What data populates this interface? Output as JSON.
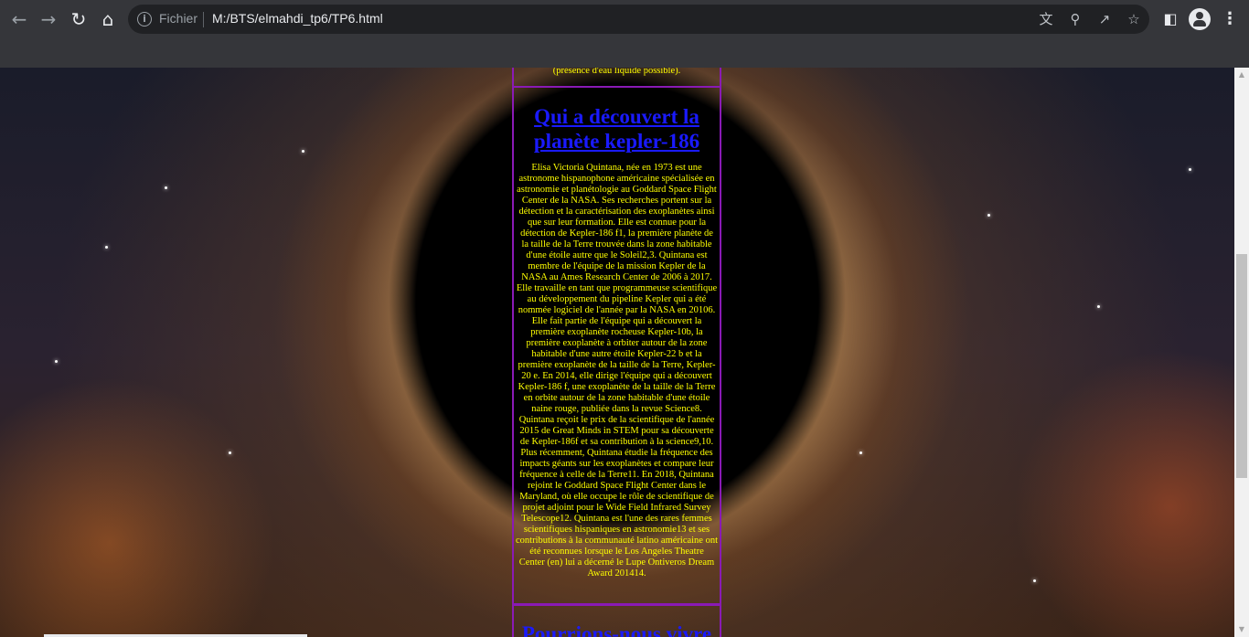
{
  "browser": {
    "scheme_label": "Fichier",
    "url": "M:/BTS/elmahdi_tp6/TP6.html",
    "icons": {
      "back": "arrow-left",
      "forward": "arrow-right",
      "reload": "reload",
      "home": "home",
      "info": "info",
      "translate": "translate",
      "zoom": "magnifier",
      "share": "share",
      "bookmark": "star",
      "side_panel": "side-panel",
      "profile": "person",
      "menu": "three-dots"
    }
  },
  "page": {
    "previous_box_fragment": "(présence d'eau liquide possible).",
    "section_title": "Qui a découvert la planète kepler-186",
    "section_text": "Elisa Victoria Quintana, née en 1973 est une astronome hispanophone américaine spécialisée en astronomie et planétologie au Goddard Space Flight Center de la NASA. Ses recherches portent sur la détection et la caractérisation des exoplanètes ainsi que sur leur formation. Elle est connue pour la détection de Kepler-186 f1, la première planète de la taille de la Terre trouvée dans la zone habitable d'une étoile autre que le Soleil2,3. Quintana est membre de l'équipe de la mission Kepler de la NASA au Ames Research Center de 2006 à 2017. Elle travaille en tant que programmeuse scientifique au développement du pipeline Kepler qui a été nommée logiciel de l'année par la NASA en 20106. Elle fait partie de l'équipe qui a découvert la première exoplanète rocheuse Kepler-10b, la première exoplanète à orbiter autour de la zone habitable d'une autre étoile Kepler-22 b et la première exoplanète de la taille de la Terre, Kepler-20 e. En 2014, elle dirige l'équipe qui a découvert Kepler-186 f, une exoplanète de la taille de la Terre en orbite autour de la zone habitable d'une étoile naine rouge, publiée dans la revue Science8. Quintana reçoit le prix de la scientifique de l'année 2015 de Great Minds in STEM pour sa découverte de Kepler-186f et sa contribution à la science9,10. Plus récemment, Quintana étudie la fréquence des impacts géants sur les exoplanètes et compare leur fréquence à celle de la Terre11. En 2018, Quintana rejoint le Goddard Space Flight Center dans le Maryland, où elle occupe le rôle de scientifique de projet adjoint pour le Wide Field Infrared Survey Telescope12. Quintana est l'une des rares femmes scientifiques hispaniques en astronomie13 et ses contributions à la communauté latino américaine ont été reconnues lorsque le Los Angeles Theatre Center (en) lui a décerné le Lupe Ontiveros Dream Award 201414.",
    "next_title_partial": "Pourrions-nous vivre"
  },
  "colors": {
    "box_border": "#8a1ab5",
    "title": "#1a1aff",
    "text": "#ffff00"
  }
}
